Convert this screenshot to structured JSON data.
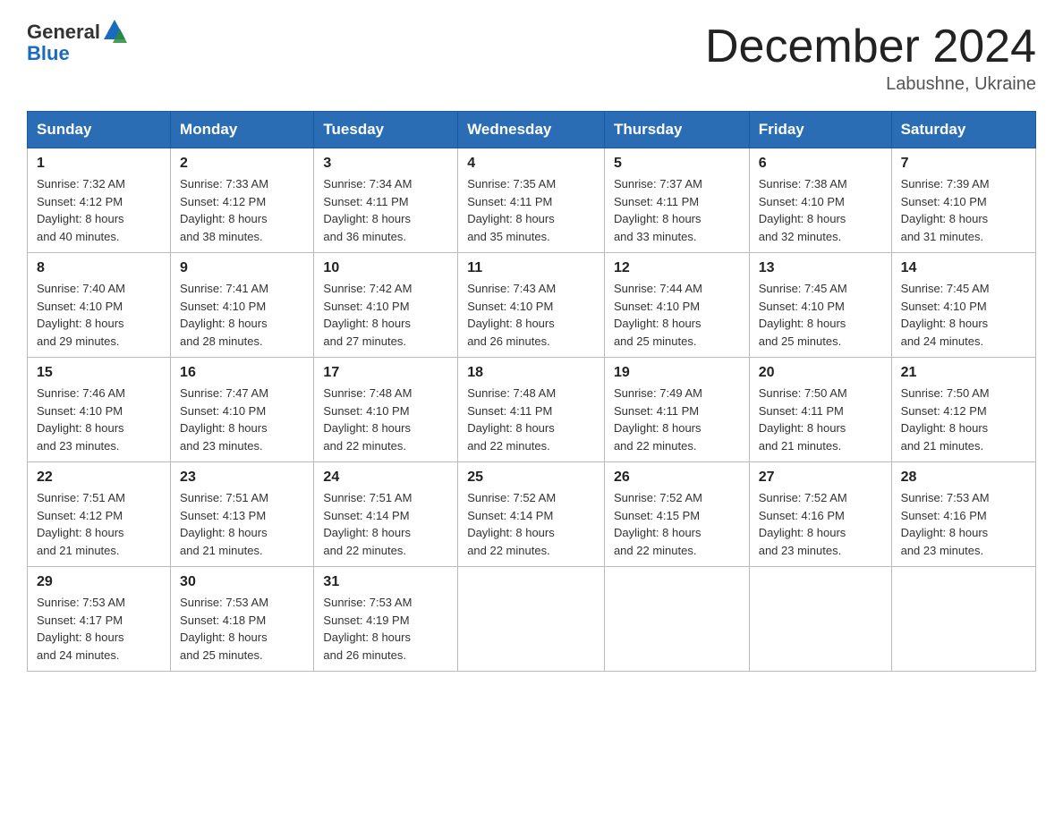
{
  "header": {
    "logo_general": "General",
    "logo_blue": "Blue",
    "month_title": "December 2024",
    "location": "Labushne, Ukraine"
  },
  "days_of_week": [
    "Sunday",
    "Monday",
    "Tuesday",
    "Wednesday",
    "Thursday",
    "Friday",
    "Saturday"
  ],
  "weeks": [
    [
      {
        "num": "1",
        "sunrise": "7:32 AM",
        "sunset": "4:12 PM",
        "daylight": "8 hours and 40 minutes."
      },
      {
        "num": "2",
        "sunrise": "7:33 AM",
        "sunset": "4:12 PM",
        "daylight": "8 hours and 38 minutes."
      },
      {
        "num": "3",
        "sunrise": "7:34 AM",
        "sunset": "4:11 PM",
        "daylight": "8 hours and 36 minutes."
      },
      {
        "num": "4",
        "sunrise": "7:35 AM",
        "sunset": "4:11 PM",
        "daylight": "8 hours and 35 minutes."
      },
      {
        "num": "5",
        "sunrise": "7:37 AM",
        "sunset": "4:11 PM",
        "daylight": "8 hours and 33 minutes."
      },
      {
        "num": "6",
        "sunrise": "7:38 AM",
        "sunset": "4:10 PM",
        "daylight": "8 hours and 32 minutes."
      },
      {
        "num": "7",
        "sunrise": "7:39 AM",
        "sunset": "4:10 PM",
        "daylight": "8 hours and 31 minutes."
      }
    ],
    [
      {
        "num": "8",
        "sunrise": "7:40 AM",
        "sunset": "4:10 PM",
        "daylight": "8 hours and 29 minutes."
      },
      {
        "num": "9",
        "sunrise": "7:41 AM",
        "sunset": "4:10 PM",
        "daylight": "8 hours and 28 minutes."
      },
      {
        "num": "10",
        "sunrise": "7:42 AM",
        "sunset": "4:10 PM",
        "daylight": "8 hours and 27 minutes."
      },
      {
        "num": "11",
        "sunrise": "7:43 AM",
        "sunset": "4:10 PM",
        "daylight": "8 hours and 26 minutes."
      },
      {
        "num": "12",
        "sunrise": "7:44 AM",
        "sunset": "4:10 PM",
        "daylight": "8 hours and 25 minutes."
      },
      {
        "num": "13",
        "sunrise": "7:45 AM",
        "sunset": "4:10 PM",
        "daylight": "8 hours and 25 minutes."
      },
      {
        "num": "14",
        "sunrise": "7:45 AM",
        "sunset": "4:10 PM",
        "daylight": "8 hours and 24 minutes."
      }
    ],
    [
      {
        "num": "15",
        "sunrise": "7:46 AM",
        "sunset": "4:10 PM",
        "daylight": "8 hours and 23 minutes."
      },
      {
        "num": "16",
        "sunrise": "7:47 AM",
        "sunset": "4:10 PM",
        "daylight": "8 hours and 23 minutes."
      },
      {
        "num": "17",
        "sunrise": "7:48 AM",
        "sunset": "4:10 PM",
        "daylight": "8 hours and 22 minutes."
      },
      {
        "num": "18",
        "sunrise": "7:48 AM",
        "sunset": "4:11 PM",
        "daylight": "8 hours and 22 minutes."
      },
      {
        "num": "19",
        "sunrise": "7:49 AM",
        "sunset": "4:11 PM",
        "daylight": "8 hours and 22 minutes."
      },
      {
        "num": "20",
        "sunrise": "7:50 AM",
        "sunset": "4:11 PM",
        "daylight": "8 hours and 21 minutes."
      },
      {
        "num": "21",
        "sunrise": "7:50 AM",
        "sunset": "4:12 PM",
        "daylight": "8 hours and 21 minutes."
      }
    ],
    [
      {
        "num": "22",
        "sunrise": "7:51 AM",
        "sunset": "4:12 PM",
        "daylight": "8 hours and 21 minutes."
      },
      {
        "num": "23",
        "sunrise": "7:51 AM",
        "sunset": "4:13 PM",
        "daylight": "8 hours and 21 minutes."
      },
      {
        "num": "24",
        "sunrise": "7:51 AM",
        "sunset": "4:14 PM",
        "daylight": "8 hours and 22 minutes."
      },
      {
        "num": "25",
        "sunrise": "7:52 AM",
        "sunset": "4:14 PM",
        "daylight": "8 hours and 22 minutes."
      },
      {
        "num": "26",
        "sunrise": "7:52 AM",
        "sunset": "4:15 PM",
        "daylight": "8 hours and 22 minutes."
      },
      {
        "num": "27",
        "sunrise": "7:52 AM",
        "sunset": "4:16 PM",
        "daylight": "8 hours and 23 minutes."
      },
      {
        "num": "28",
        "sunrise": "7:53 AM",
        "sunset": "4:16 PM",
        "daylight": "8 hours and 23 minutes."
      }
    ],
    [
      {
        "num": "29",
        "sunrise": "7:53 AM",
        "sunset": "4:17 PM",
        "daylight": "8 hours and 24 minutes."
      },
      {
        "num": "30",
        "sunrise": "7:53 AM",
        "sunset": "4:18 PM",
        "daylight": "8 hours and 25 minutes."
      },
      {
        "num": "31",
        "sunrise": "7:53 AM",
        "sunset": "4:19 PM",
        "daylight": "8 hours and 26 minutes."
      },
      null,
      null,
      null,
      null
    ]
  ],
  "labels": {
    "sunrise": "Sunrise:",
    "sunset": "Sunset:",
    "daylight": "Daylight:"
  }
}
